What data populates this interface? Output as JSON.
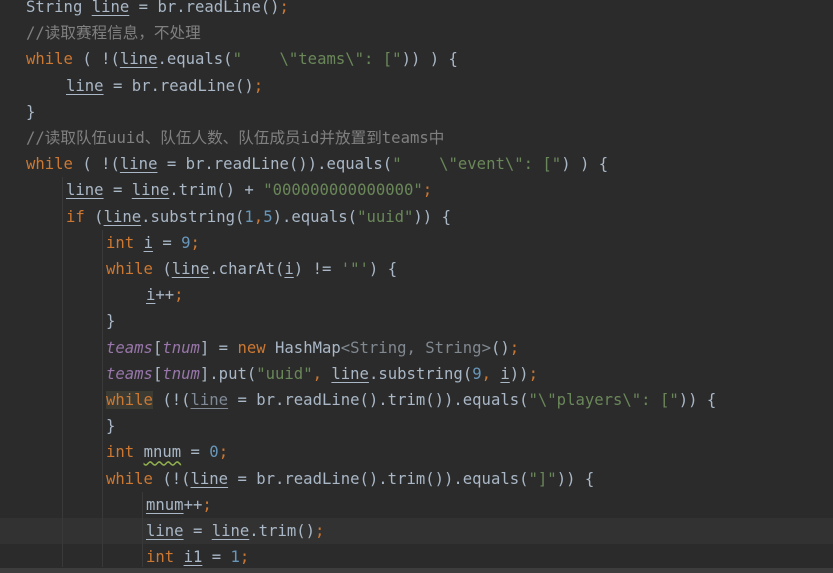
{
  "colors": {
    "background": "#2b2b2b",
    "keyword": "#cc7832",
    "string": "#6a8759",
    "number": "#6897bb",
    "comment": "#808080",
    "field": "#9876aa",
    "plain": "#a9b7c6"
  },
  "code_lines": [
    {
      "indent": 0,
      "tokens": [
        {
          "text": "String ",
          "kind": "p"
        },
        {
          "text": "line",
          "kind": "var"
        },
        {
          "text": " = br.readLine()",
          "kind": "p"
        },
        {
          "text": ";",
          "kind": "kw"
        }
      ]
    },
    {
      "indent": 0,
      "tokens": [
        {
          "text": "//读取赛程信息，不处理",
          "kind": "cmt"
        }
      ]
    },
    {
      "indent": 0,
      "tokens": [
        {
          "text": "while",
          "kind": "kw"
        },
        {
          "text": " ( !(",
          "kind": "p"
        },
        {
          "text": "line",
          "kind": "var"
        },
        {
          "text": ".equals(",
          "kind": "p"
        },
        {
          "text": "\"    \\\"teams\\\": [\"",
          "kind": "str"
        },
        {
          "text": ")) ) {",
          "kind": "p"
        }
      ]
    },
    {
      "indent": 1,
      "tokens": [
        {
          "text": "line",
          "kind": "var"
        },
        {
          "text": " = br.readLine()",
          "kind": "p"
        },
        {
          "text": ";",
          "kind": "kw"
        }
      ]
    },
    {
      "indent": 0,
      "tokens": [
        {
          "text": "}",
          "kind": "p"
        }
      ]
    },
    {
      "indent": 0,
      "tokens": [
        {
          "text": "//读取队伍uuid、队伍人数、队伍成员id并放置到teams中",
          "kind": "cmt"
        }
      ]
    },
    {
      "indent": 0,
      "tokens": [
        {
          "text": "while",
          "kind": "kw"
        },
        {
          "text": " ( !(",
          "kind": "p"
        },
        {
          "text": "line",
          "kind": "var"
        },
        {
          "text": " = br.readLine()).equals(",
          "kind": "p"
        },
        {
          "text": "\"    \\\"event\\\": [\"",
          "kind": "str"
        },
        {
          "text": ") ) {",
          "kind": "p"
        }
      ]
    },
    {
      "indent": 1,
      "tokens": [
        {
          "text": "line",
          "kind": "var"
        },
        {
          "text": " = ",
          "kind": "p"
        },
        {
          "text": "line",
          "kind": "var"
        },
        {
          "text": ".trim() + ",
          "kind": "p"
        },
        {
          "text": "\"000000000000000\"",
          "kind": "str"
        },
        {
          "text": ";",
          "kind": "kw"
        }
      ]
    },
    {
      "indent": 1,
      "tokens": [
        {
          "text": "if",
          "kind": "kw"
        },
        {
          "text": " (",
          "kind": "p"
        },
        {
          "text": "line",
          "kind": "var"
        },
        {
          "text": ".substring(",
          "kind": "p"
        },
        {
          "text": "1",
          "kind": "num"
        },
        {
          "text": ",",
          "kind": "kw"
        },
        {
          "text": "5",
          "kind": "num"
        },
        {
          "text": ").equals(",
          "kind": "p"
        },
        {
          "text": "\"uuid\"",
          "kind": "str"
        },
        {
          "text": ")) {",
          "kind": "p"
        }
      ]
    },
    {
      "indent": 2,
      "tokens": [
        {
          "text": "int ",
          "kind": "kw"
        },
        {
          "text": "i",
          "kind": "var"
        },
        {
          "text": " = ",
          "kind": "p"
        },
        {
          "text": "9",
          "kind": "num"
        },
        {
          "text": ";",
          "kind": "kw"
        }
      ]
    },
    {
      "indent": 2,
      "tokens": [
        {
          "text": "while",
          "kind": "kw"
        },
        {
          "text": " (",
          "kind": "p"
        },
        {
          "text": "line",
          "kind": "var"
        },
        {
          "text": ".charAt(",
          "kind": "p"
        },
        {
          "text": "i",
          "kind": "var"
        },
        {
          "text": ") != ",
          "kind": "p"
        },
        {
          "text": "'\"'",
          "kind": "str"
        },
        {
          "text": ") {",
          "kind": "p"
        }
      ]
    },
    {
      "indent": 3,
      "tokens": [
        {
          "text": "i",
          "kind": "var"
        },
        {
          "text": "++",
          "kind": "p"
        },
        {
          "text": ";",
          "kind": "kw"
        }
      ]
    },
    {
      "indent": 2,
      "tokens": [
        {
          "text": "}",
          "kind": "p"
        }
      ]
    },
    {
      "indent": 2,
      "tokens": [
        {
          "text": "teams",
          "kind": "fld"
        },
        {
          "text": "[",
          "kind": "p"
        },
        {
          "text": "tnum",
          "kind": "fld"
        },
        {
          "text": "] = ",
          "kind": "p"
        },
        {
          "text": "new ",
          "kind": "kw"
        },
        {
          "text": "HashMap",
          "kind": "p"
        },
        {
          "text": "<String, String>",
          "kind": "gen"
        },
        {
          "text": "()",
          "kind": "p"
        },
        {
          "text": ";",
          "kind": "kw"
        }
      ]
    },
    {
      "indent": 2,
      "tokens": [
        {
          "text": "teams",
          "kind": "fld"
        },
        {
          "text": "[",
          "kind": "p"
        },
        {
          "text": "tnum",
          "kind": "fld"
        },
        {
          "text": "].put(",
          "kind": "p"
        },
        {
          "text": "\"uuid\"",
          "kind": "str"
        },
        {
          "text": ", ",
          "kind": "kw"
        },
        {
          "text": "line",
          "kind": "var"
        },
        {
          "text": ".substring(",
          "kind": "p"
        },
        {
          "text": "9",
          "kind": "num"
        },
        {
          "text": ", ",
          "kind": "kw"
        },
        {
          "text": "i",
          "kind": "var"
        },
        {
          "text": "))",
          "kind": "p"
        },
        {
          "text": ";",
          "kind": "kw"
        }
      ]
    },
    {
      "indent": 2,
      "tokens": [
        {
          "text": "while",
          "kind": "hl"
        },
        {
          "text": " (!(",
          "kind": "p"
        },
        {
          "text": "line",
          "kind": "vardim"
        },
        {
          "text": " = br.readLine().trim()).equals(",
          "kind": "p"
        },
        {
          "text": "\"\\\"players\\\": [\"",
          "kind": "str"
        },
        {
          "text": ")) {",
          "kind": "p"
        }
      ]
    },
    {
      "indent": 2,
      "tokens": [
        {
          "text": "}",
          "kind": "p"
        }
      ]
    },
    {
      "indent": 2,
      "tokens": [
        {
          "text": "int ",
          "kind": "kw"
        },
        {
          "text": "mnum",
          "kind": "varwarn"
        },
        {
          "text": " = ",
          "kind": "p"
        },
        {
          "text": "0",
          "kind": "num"
        },
        {
          "text": ";",
          "kind": "kw"
        }
      ]
    },
    {
      "indent": 2,
      "tokens": [
        {
          "text": "while",
          "kind": "kw"
        },
        {
          "text": " (!(",
          "kind": "p"
        },
        {
          "text": "line",
          "kind": "var"
        },
        {
          "text": " = br.readLine().trim()).equals(",
          "kind": "p"
        },
        {
          "text": "\"]\"",
          "kind": "str"
        },
        {
          "text": ")) {",
          "kind": "p"
        }
      ]
    },
    {
      "indent": 3,
      "tokens": [
        {
          "text": "mnum",
          "kind": "var"
        },
        {
          "text": "++",
          "kind": "p"
        },
        {
          "text": ";",
          "kind": "kw"
        }
      ]
    },
    {
      "indent": 3,
      "current": true,
      "tokens": [
        {
          "text": "line",
          "kind": "var"
        },
        {
          "text": " = ",
          "kind": "p"
        },
        {
          "text": "line",
          "kind": "var"
        },
        {
          "text": ".trim()",
          "kind": "p"
        },
        {
          "text": ";",
          "kind": "kw"
        }
      ]
    },
    {
      "indent": 3,
      "tokens": [
        {
          "text": "int ",
          "kind": "kw"
        },
        {
          "text": "i1",
          "kind": "var"
        },
        {
          "text": " = ",
          "kind": "p"
        },
        {
          "text": "1",
          "kind": "num"
        },
        {
          "text": ";",
          "kind": "kw"
        }
      ]
    }
  ]
}
